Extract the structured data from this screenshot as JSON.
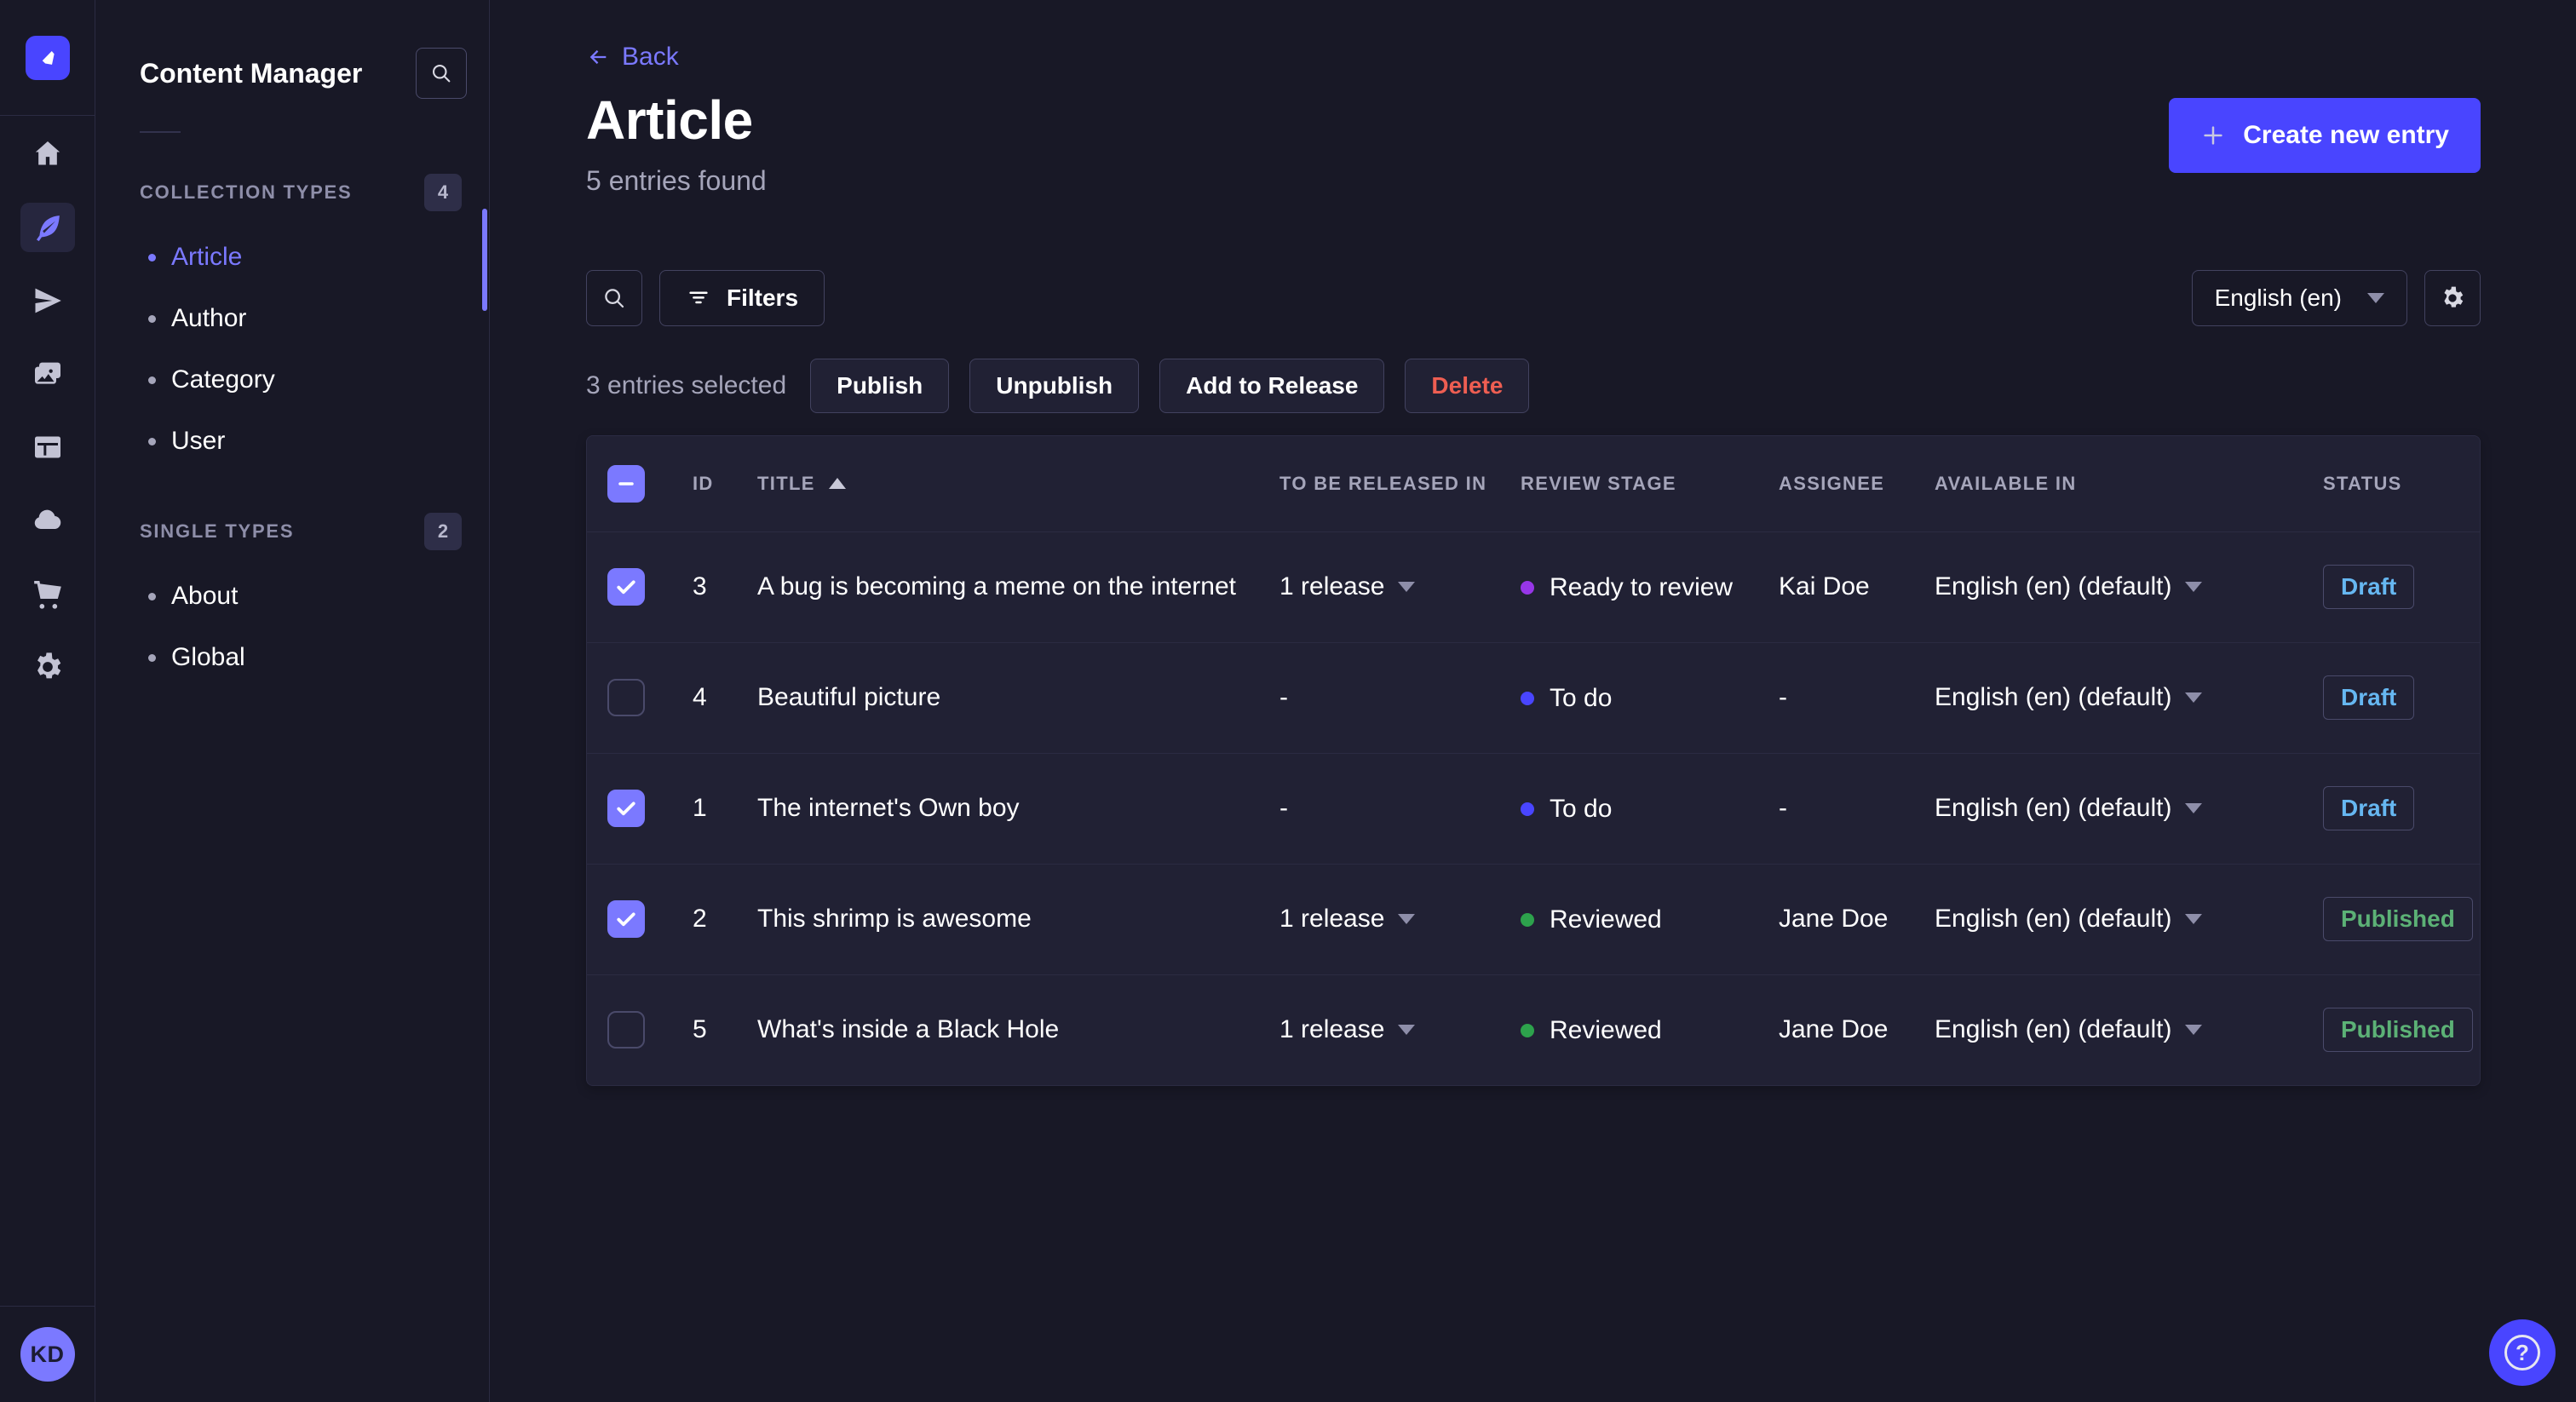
{
  "nav": {
    "avatar_initials": "KD",
    "icons": [
      "home-icon",
      "content-manager-feather-icon",
      "releases-send-icon",
      "media-library-icon",
      "content-type-builder-icon",
      "cloud-icon",
      "marketplace-cart-icon",
      "settings-gear-icon"
    ],
    "active_icon": "content-manager-feather-icon"
  },
  "sidebar": {
    "title": "Content Manager",
    "sections": [
      {
        "label": "COLLECTION TYPES",
        "count": "4",
        "items": [
          {
            "label": "Article",
            "active": true
          },
          {
            "label": "Author",
            "active": false
          },
          {
            "label": "Category",
            "active": false
          },
          {
            "label": "User",
            "active": false
          }
        ]
      },
      {
        "label": "SINGLE TYPES",
        "count": "2",
        "items": [
          {
            "label": "About",
            "active": false
          },
          {
            "label": "Global",
            "active": false
          }
        ]
      }
    ]
  },
  "header": {
    "back_label": "Back",
    "title": "Article",
    "subtitle": "5 entries found",
    "create_button": "Create new entry"
  },
  "toolbar": {
    "filters_label": "Filters",
    "locale_value": "English (en)"
  },
  "selection": {
    "text": "3 entries selected",
    "actions": [
      {
        "label": "Publish",
        "danger": false
      },
      {
        "label": "Unpublish",
        "danger": false
      },
      {
        "label": "Add to Release",
        "danger": false
      },
      {
        "label": "Delete",
        "danger": true
      }
    ]
  },
  "table": {
    "columns": [
      "ID",
      "TITLE",
      "TO BE RELEASED IN",
      "REVIEW STAGE",
      "ASSIGNEE",
      "AVAILABLE IN",
      "STATUS"
    ],
    "sort_column": "TITLE",
    "sort_direction": "asc",
    "header_checkbox_state": "indeterminate",
    "rows": [
      {
        "checked": true,
        "id": "3",
        "title": "A bug is becoming a meme on the internet",
        "release": "1 release",
        "review_stage": "Ready to review",
        "review_color": "#9736e8",
        "assignee": "Kai Doe",
        "available_in": "English (en) (default)",
        "status": "Draft",
        "status_color": "#66b7f1"
      },
      {
        "checked": false,
        "id": "4",
        "title": "Beautiful picture",
        "release": "-",
        "review_stage": "To do",
        "review_color": "#4945ff",
        "assignee": "-",
        "available_in": "English (en) (default)",
        "status": "Draft",
        "status_color": "#66b7f1"
      },
      {
        "checked": true,
        "id": "1",
        "title": "The internet's Own boy",
        "release": "-",
        "review_stage": "To do",
        "review_color": "#4945ff",
        "assignee": "-",
        "available_in": "English (en) (default)",
        "status": "Draft",
        "status_color": "#66b7f1"
      },
      {
        "checked": true,
        "id": "2",
        "title": "This shrimp is awesome",
        "release": "1 release",
        "review_stage": "Reviewed",
        "review_color": "#2da24c",
        "assignee": "Jane Doe",
        "available_in": "English (en) (default)",
        "status": "Published",
        "status_color": "#5cb176"
      },
      {
        "checked": false,
        "id": "5",
        "title": "What's inside a Black Hole",
        "release": "1 release",
        "review_stage": "Reviewed",
        "review_color": "#2da24c",
        "assignee": "Jane Doe",
        "available_in": "English (en) (default)",
        "status": "Published",
        "status_color": "#5cb176"
      }
    ]
  },
  "help": {
    "glyph": "?"
  },
  "colors": {
    "brand": "#4945ff",
    "accent": "#7b79ff",
    "surface": "#212134",
    "background": "#181826",
    "border_subtle": "#2b2b42",
    "border_strong": "#42425f",
    "draft": "#66b7f1",
    "published": "#5cb176",
    "danger": "#ee5e52",
    "stage_ready_to_review": "#9736e8",
    "stage_to_do": "#4945ff",
    "stage_reviewed": "#2da24c"
  }
}
